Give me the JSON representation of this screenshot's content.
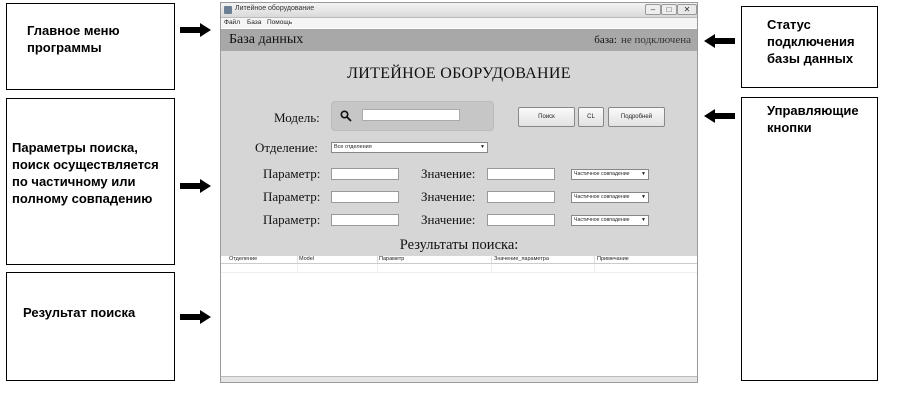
{
  "callouts": {
    "main_menu": "Главное меню программы",
    "search_params": "Параметры поиска, поиск осуществляется по частичному или полному совпадению",
    "search_result": "Результат поиска",
    "db_status": "Статус подключения базы данных",
    "control_buttons": "Управляющие кнопки"
  },
  "window": {
    "title": "Литейное оборудование",
    "controls": {
      "minimize": "–",
      "maximize": "□",
      "close": "✕"
    }
  },
  "menu": [
    "Файл",
    "База",
    "Помощь"
  ],
  "db_bar": {
    "title": "База данных",
    "status_label": "база:",
    "status_value": "не подключена"
  },
  "main_title": "ЛИТЕЙНОЕ ОБОРУДОВАНИЕ",
  "model": {
    "label": "Модель:",
    "value": ""
  },
  "buttons": {
    "search": "Поиск",
    "clear": "CL",
    "details": "Подробней"
  },
  "department": {
    "label": "Отделение:",
    "selected": "Все отделения"
  },
  "params": [
    {
      "param_label": "Параметр:",
      "value_label": "Значение:",
      "match": "Частичное совпадение"
    },
    {
      "param_label": "Параметр:",
      "value_label": "Значение:",
      "match": "Частичное совпадение"
    },
    {
      "param_label": "Параметр:",
      "value_label": "Значение:",
      "match": "Частичное совпадение"
    }
  ],
  "results": {
    "title": "Результаты поиска:",
    "columns": [
      "Отделение",
      "Model",
      "Параметр",
      "Значение_параметра",
      "Примечание"
    ]
  },
  "icons": {
    "search": "search-icon",
    "dropdown": "chevron-down-icon",
    "arrow": "arrow-icon"
  }
}
